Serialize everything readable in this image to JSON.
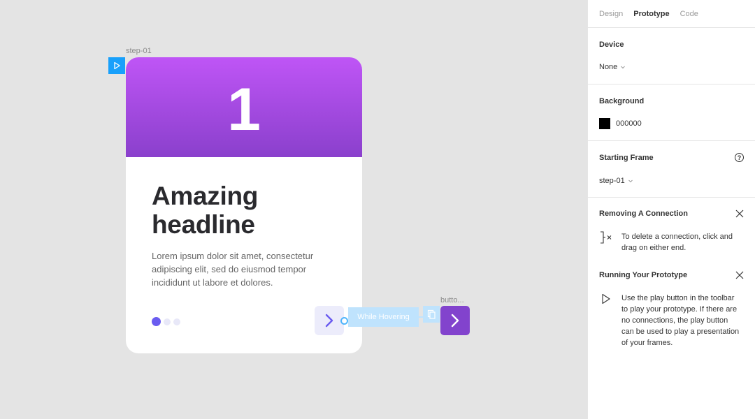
{
  "canvas": {
    "frame_label": "step-01",
    "button_label": "butto...",
    "card": {
      "number": "1",
      "headline": "Amazing headline",
      "body": "Lorem ipsum dolor sit amet, consectetur adipiscing elit, sed do eiusmod tempor incididunt ut labore et dolores."
    },
    "interaction": "While Hovering"
  },
  "panel": {
    "tabs": [
      {
        "label": "Design"
      },
      {
        "label": "Prototype"
      },
      {
        "label": "Code"
      }
    ],
    "device": {
      "title": "Device",
      "value": "None"
    },
    "background": {
      "title": "Background",
      "value": "000000"
    },
    "starting_frame": {
      "title": "Starting Frame",
      "value": "step-01"
    },
    "tips": [
      {
        "title": "Removing A Connection",
        "text": "To delete a connection, click and drag on either end."
      },
      {
        "title": "Running Your Prototype",
        "text": "Use the play button in the toolbar to play your prototype. If there are no connections, the play button can be used to play a presentation of your frames."
      }
    ]
  },
  "colors": {
    "accent": "#18a0fb",
    "header_gradient_top": "#bf55f6",
    "header_gradient_bottom": "#8a40cc",
    "button_purple": "#8243cd",
    "dot_active": "#6a5cf0"
  }
}
